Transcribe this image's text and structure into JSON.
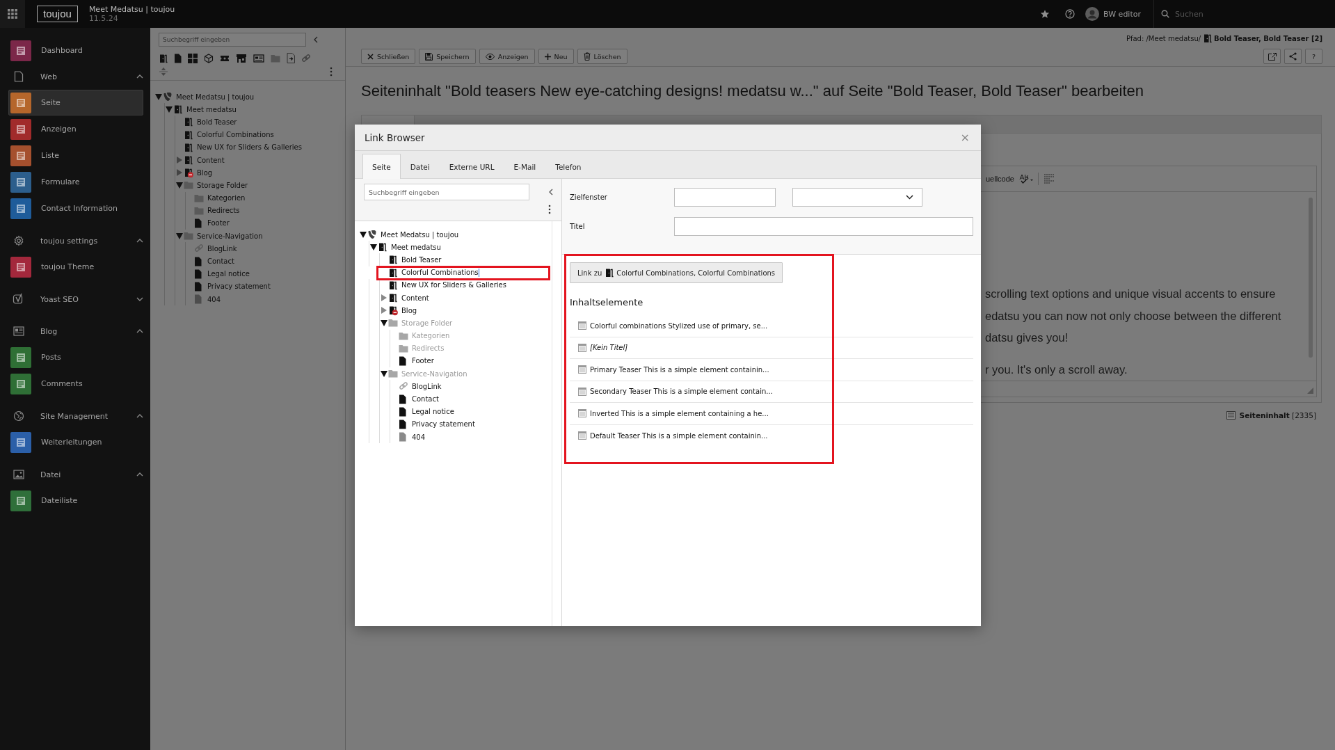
{
  "topbar": {
    "logo": "toujou",
    "site_title": "Meet Medatsu | toujou",
    "version": "11.5.24",
    "user": "BW editor",
    "search": {
      "placeholder": "Suchen"
    }
  },
  "sidebar": {
    "items": [
      {
        "kind": "module",
        "label": "Dashboard",
        "color": "#7b2749",
        "selected": false
      },
      {
        "kind": "group",
        "label": "Web",
        "expanded": true,
        "children": [
          {
            "kind": "module",
            "label": "Seite",
            "color": "#b5662b",
            "selected": true
          },
          {
            "kind": "module",
            "label": "Anzeigen",
            "color": "#a12b2b",
            "selected": false
          },
          {
            "kind": "module",
            "label": "Liste",
            "color": "#a5502e",
            "selected": false
          },
          {
            "kind": "module",
            "label": "Formulare",
            "color": "#2c5e8c",
            "selected": false
          },
          {
            "kind": "module",
            "label": "Contact Information",
            "color": "#1f5c9a",
            "selected": false
          }
        ]
      },
      {
        "kind": "group",
        "label": "toujou settings",
        "expanded": true,
        "children": [
          {
            "kind": "module",
            "label": "toujou Theme",
            "color": "#a3283c",
            "selected": false
          }
        ]
      },
      {
        "kind": "group",
        "label": "Yoast SEO",
        "expanded": false
      },
      {
        "kind": "group",
        "label": "Blog",
        "expanded": true,
        "children": [
          {
            "kind": "module",
            "label": "Posts",
            "color": "#2f6f35",
            "selected": false
          },
          {
            "kind": "module",
            "label": "Comments",
            "color": "#2f6f36",
            "selected": false
          }
        ]
      },
      {
        "kind": "group",
        "label": "Site Management",
        "expanded": true,
        "children": [
          {
            "kind": "module",
            "label": "Weiterleitungen",
            "color": "#2b5fa8",
            "selected": false
          }
        ]
      },
      {
        "kind": "group",
        "label": "Datei",
        "expanded": true,
        "children": [
          {
            "kind": "module",
            "label": "Dateiliste",
            "color": "#2f6f3a",
            "selected": false
          }
        ]
      }
    ]
  },
  "page_tree": {
    "search": {
      "placeholder": "Suchbegriff eingeben"
    },
    "items": [
      {
        "label": "Meet Medatsu | toujou",
        "kind": "site",
        "expanded": true,
        "children": [
          {
            "label": "Meet medatsu",
            "kind": "page",
            "expanded": true,
            "children": [
              {
                "label": "Bold Teaser",
                "kind": "page"
              },
              {
                "label": "Colorful Combinations",
                "kind": "page"
              },
              {
                "label": "New UX for Sliders & Galleries",
                "kind": "page"
              },
              {
                "label": "Content",
                "kind": "page",
                "expanded": false
              },
              {
                "label": "Blog",
                "kind": "restricted",
                "expanded": false
              },
              {
                "label": "Storage Folder",
                "kind": "folder",
                "expanded": true,
                "children": [
                  {
                    "label": "Kategorien",
                    "kind": "folder"
                  },
                  {
                    "label": "Redirects",
                    "kind": "folder"
                  },
                  {
                    "label": "Footer",
                    "kind": "doc"
                  }
                ]
              },
              {
                "label": "Service-Navigation",
                "kind": "folder",
                "expanded": true,
                "children": [
                  {
                    "label": "BlogLink",
                    "kind": "link"
                  },
                  {
                    "label": "Contact",
                    "kind": "doc"
                  },
                  {
                    "label": "Legal notice",
                    "kind": "doc"
                  },
                  {
                    "label": "Privacy statement",
                    "kind": "doc"
                  },
                  {
                    "label": "404",
                    "kind": "doc-grey"
                  }
                ]
              }
            ]
          }
        ]
      }
    ]
  },
  "document": {
    "path_prefix": "Pfad: /Meet medatsu/",
    "path_page": "Bold Teaser, Bold Teaser [2]",
    "buttons": [
      {
        "label": "Schließen"
      },
      {
        "label": "Speichern"
      },
      {
        "label": "Anzeigen"
      },
      {
        "label": "Neu"
      },
      {
        "label": "Löschen"
      }
    ],
    "help_label": "?",
    "heading": "Seiteninhalt \"Bold teasers New eye-catching designs! medatsu w...\" auf Seite \"Bold Teaser, Bold Teaser\" bearbeiten",
    "editor": {
      "toolbar_label": "uellcode",
      "lines": [
        "scrolling text options and unique  visual accents to ensure",
        "edatsu you can now not only choose between the different",
        "datsu gives you!",
        "r you. It's only a scroll away."
      ]
    },
    "record_info": "**Seiteninhalt** [2335]"
  },
  "link_browser": {
    "title": "Link Browser",
    "close_label": "×",
    "tabs": [
      {
        "label": "Seite",
        "selected": true
      },
      {
        "label": "Datei",
        "selected": false
      },
      {
        "label": "Externe URL",
        "selected": false
      },
      {
        "label": "E-Mail",
        "selected": false
      },
      {
        "label": "Telefon",
        "selected": false
      }
    ],
    "search": {
      "placeholder": "Suchbegriff eingeben"
    },
    "tree": {
      "items": [
        {
          "label": "Meet Medatsu | toujou",
          "kind": "site",
          "selected": false,
          "disabled": false,
          "expanded": true,
          "children": [
            {
              "label": "Meet medatsu",
              "kind": "page",
              "selected": false,
              "disabled": false,
              "expanded": true,
              "children": [
                {
                  "label": "Bold Teaser",
                  "kind": "page",
                  "selected": false,
                  "disabled": false
                },
                {
                  "label": "Colorful Combinations",
                  "kind": "page",
                  "selected": true,
                  "disabled": false
                },
                {
                  "label": "New UX for Sliders & Galleries",
                  "kind": "page",
                  "selected": false,
                  "disabled": false
                },
                {
                  "label": "Content",
                  "kind": "page",
                  "selected": false,
                  "disabled": false,
                  "expanded": false
                },
                {
                  "label": "Blog",
                  "kind": "restricted",
                  "selected": false,
                  "disabled": false,
                  "expanded": false
                },
                {
                  "label": "Storage Folder",
                  "kind": "folder",
                  "selected": false,
                  "disabled": true,
                  "expanded": true,
                  "children": [
                    {
                      "label": "Kategorien",
                      "kind": "folder",
                      "selected": false,
                      "disabled": true
                    },
                    {
                      "label": "Redirects",
                      "kind": "folder",
                      "selected": false,
                      "disabled": true
                    },
                    {
                      "label": "Footer",
                      "kind": "doc",
                      "selected": false,
                      "disabled": false
                    }
                  ]
                },
                {
                  "label": "Service-Navigation",
                  "kind": "folder",
                  "selected": false,
                  "disabled": true,
                  "expanded": true,
                  "children": [
                    {
                      "label": "BlogLink",
                      "kind": "link",
                      "selected": false,
                      "disabled": false
                    },
                    {
                      "label": "Contact",
                      "kind": "doc",
                      "selected": false,
                      "disabled": false
                    },
                    {
                      "label": "Legal notice",
                      "kind": "doc",
                      "selected": false,
                      "disabled": false
                    },
                    {
                      "label": "Privacy statement",
                      "kind": "doc",
                      "selected": false,
                      "disabled": false
                    },
                    {
                      "label": "404",
                      "kind": "doc-grey",
                      "selected": false,
                      "disabled": false
                    }
                  ]
                }
              ]
            }
          ]
        }
      ]
    },
    "fields": [
      {
        "label": "Zielfenster",
        "kind": "target"
      },
      {
        "label": "Titel",
        "kind": "text"
      }
    ],
    "link_button": {
      "prefix": "Link zu",
      "target": "Colorful Combinations, Colorful Combinations"
    },
    "content_panel": {
      "highlighted": true,
      "heading": "Inhaltselemente",
      "items": [
        {
          "label": "Colorful combinations Stylized use of primary, se...",
          "untitled": false
        },
        {
          "label": "[Kein Titel]",
          "untitled": true
        },
        {
          "label": "Primary Teaser This is a simple element containin...",
          "untitled": false
        },
        {
          "label": "Secondary Teaser This is a simple element contain...",
          "untitled": false
        },
        {
          "label": "Inverted This is a simple element containing a he...",
          "untitled": false
        },
        {
          "label": "Default Teaser This is a simple element containin...",
          "untitled": false
        }
      ]
    }
  }
}
